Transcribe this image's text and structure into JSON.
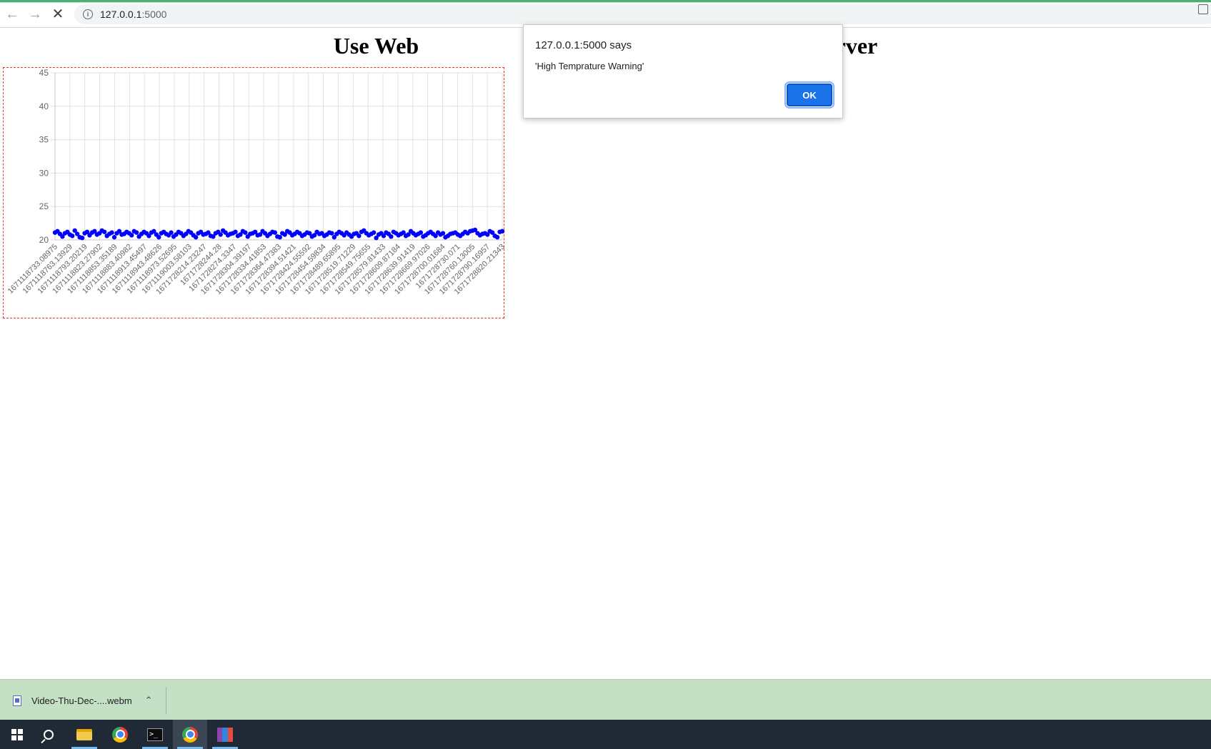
{
  "browser": {
    "url_host": "127.0.0.1",
    "url_port": ":5000",
    "back_icon": "arrow-left-icon",
    "forward_icon": "arrow-right-icon",
    "stop_icon": "close-icon",
    "back_glyph": "←",
    "forward_glyph": "→",
    "stop_glyph": "✕"
  },
  "page": {
    "title_left": "Use Web",
    "title_right": "T server"
  },
  "alert": {
    "origin": "127.0.0.1:5000 says",
    "message": "'High Temprature Warning'",
    "ok_label": "OK"
  },
  "download_shelf": {
    "file_name": "Video-Thu-Dec-....webm",
    "chevron": "⌃"
  },
  "taskbar": {
    "items": [
      "windows-start-icon",
      "search-icon",
      "file-explorer-icon",
      "chrome-icon",
      "terminal-icon",
      "chrome-icon",
      "winrar-icon"
    ],
    "terminal_glyph": ">_"
  },
  "colors": {
    "point": "#0000ff",
    "grid": "#e0e0e0",
    "border": "#e53935",
    "accent": "#1a73e8"
  },
  "chart_data": {
    "type": "scatter",
    "title": "",
    "xlabel": "",
    "ylabel": "",
    "ylim": [
      20,
      45
    ],
    "yticks": [
      20,
      25,
      30,
      35,
      40,
      45
    ],
    "grid": true,
    "x_tick_labels": [
      "1671118733.08975",
      "1671118763.13929",
      "1671118793.20219",
      "1671118823.27902",
      "1671118853.35189",
      "1671118883.40982",
      "1671118913.45497",
      "1671118943.48626",
      "1671118973.52695",
      "1671119003.58103",
      "1671728214.23247",
      "1671728244.28",
      "1671728274.3347",
      "1671728304.39197",
      "1671728334.41853",
      "1671728364.47383",
      "1671728394.51421",
      "1671728424.55592",
      "1671728454.59834",
      "1671728489.65895",
      "1671728519.71229",
      "1671728549.75655",
      "1671728579.81433",
      "1671728609.87184",
      "1671728639.91419",
      "1671728669.97026",
      "1671728700.01684",
      "1671728730.071",
      "1671728760.13005",
      "1671728790.16957",
      "1671728820.21343"
    ],
    "series": [
      {
        "values": [
          21.1,
          21.3,
          20.9,
          20.5,
          21.0,
          21.2,
          20.8,
          20.6,
          21.4,
          20.9,
          20.4,
          20.3,
          21.0,
          21.2,
          20.7,
          21.1,
          21.3,
          20.8,
          21.0,
          21.4,
          21.2,
          20.6,
          20.9,
          21.1,
          20.4,
          21.0,
          21.3,
          20.8,
          20.9,
          21.2,
          21.0,
          20.7,
          21.3,
          21.1,
          20.5,
          20.9,
          21.2,
          21.0,
          20.6,
          21.1,
          21.3,
          20.8,
          20.4,
          21.0,
          21.2,
          20.9,
          20.7,
          21.1,
          20.5,
          20.8,
          21.2,
          21.0,
          20.6,
          20.9,
          21.3,
          21.1,
          20.7,
          20.4,
          21.0,
          21.2,
          20.8,
          20.9,
          21.1,
          20.6,
          20.5,
          21.0,
          21.2,
          20.8,
          21.4,
          21.1,
          20.7,
          20.9,
          21.0,
          21.2,
          20.6,
          20.8,
          21.3,
          21.1,
          20.5,
          20.9,
          21.0,
          21.2,
          20.7,
          20.8,
          21.3,
          21.0,
          20.6,
          20.9,
          21.2,
          21.1,
          20.5,
          20.4,
          21.0,
          20.8,
          21.3,
          21.1,
          20.7,
          20.9,
          21.2,
          21.0,
          20.6,
          20.8,
          21.1,
          21.0,
          20.5,
          20.7,
          21.2,
          20.9,
          21.0,
          20.6,
          20.8,
          21.1,
          21.0,
          20.4,
          20.9,
          21.2,
          21.0,
          20.7,
          21.1,
          20.8,
          20.5,
          20.9,
          21.0,
          20.6,
          21.2,
          21.4,
          21.0,
          20.7,
          20.9,
          21.1,
          20.3,
          20.8,
          21.0,
          20.6,
          21.1,
          20.9,
          20.5,
          21.2,
          21.0,
          20.7,
          20.9,
          21.1,
          20.6,
          20.8,
          21.3,
          21.0,
          20.7,
          20.9,
          21.1,
          20.5,
          20.7,
          21.0,
          21.2,
          20.9,
          20.6,
          21.1,
          20.8,
          21.0,
          20.4,
          20.6,
          20.9,
          21.0,
          21.1,
          20.8,
          20.6,
          20.9,
          21.2,
          21.0,
          21.3,
          21.4,
          21.5,
          21.0,
          20.7,
          20.9,
          21.0,
          20.8,
          21.3,
          21.1,
          20.6,
          20.4,
          21.2,
          21.3
        ]
      }
    ]
  }
}
